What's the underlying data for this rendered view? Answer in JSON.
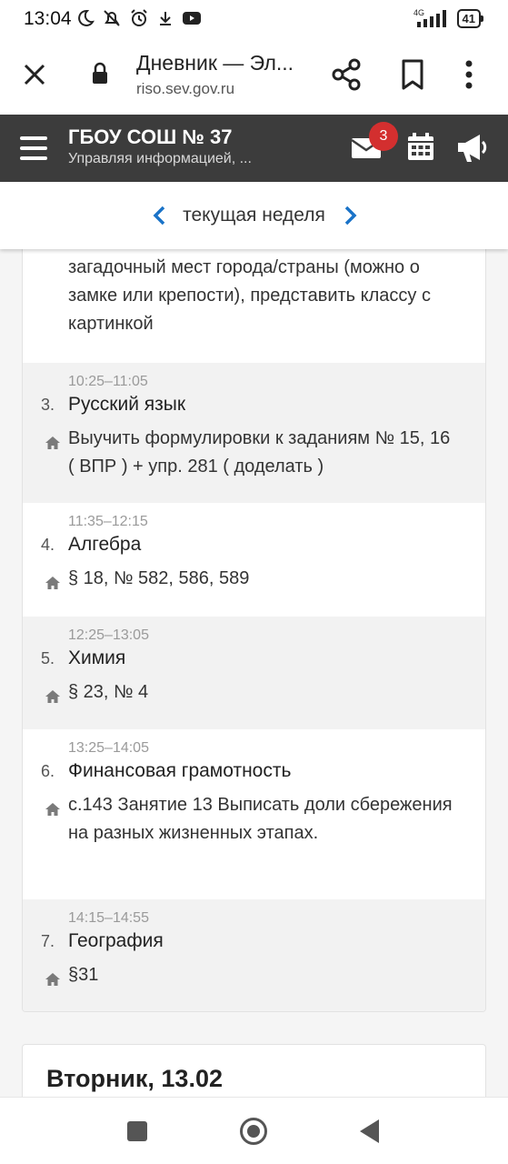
{
  "status_bar": {
    "time": "13:04",
    "network": "4G",
    "battery": "41"
  },
  "browser": {
    "page_title": "Дневник — Эл...",
    "url": "riso.sev.gov.ru"
  },
  "app_header": {
    "title": "ГБОУ СОШ № 37",
    "subtitle": "Управляя информацией, ...",
    "mail_badge": "3"
  },
  "week_selector": {
    "label": "текущая неделя"
  },
  "day": {
    "previous_homework": "загадочный мест города/страны (можно о замке или крепости), представить классу с картинкой",
    "lessons": [
      {
        "number": "3.",
        "time": "10:25–11:05",
        "subject": "Русский язык",
        "homework": "Выучить формулировки к заданиям № 15, 16 ( ВПР ) + упр. 281 ( доделать )"
      },
      {
        "number": "4.",
        "time": "11:35–12:15",
        "subject": "Алгебра",
        "homework": "§ 18, № 582, 586, 589"
      },
      {
        "number": "5.",
        "time": "12:25–13:05",
        "subject": "Химия",
        "homework": "§ 23, № 4"
      },
      {
        "number": "6.",
        "time": "13:25–14:05",
        "subject": "Финансовая грамотность",
        "homework": "с.143 Занятие 13 Выписать доли сбережения на разных жизненных этапах."
      },
      {
        "number": "7.",
        "time": "14:15–14:55",
        "subject": "География",
        "homework": "§31"
      }
    ]
  },
  "next_day": {
    "title": "Вторник, 13.02"
  },
  "colors": {
    "app_header_bg": "#3c3c3c",
    "accent_blue": "#1a73c8",
    "badge_red": "#d32f2f"
  }
}
